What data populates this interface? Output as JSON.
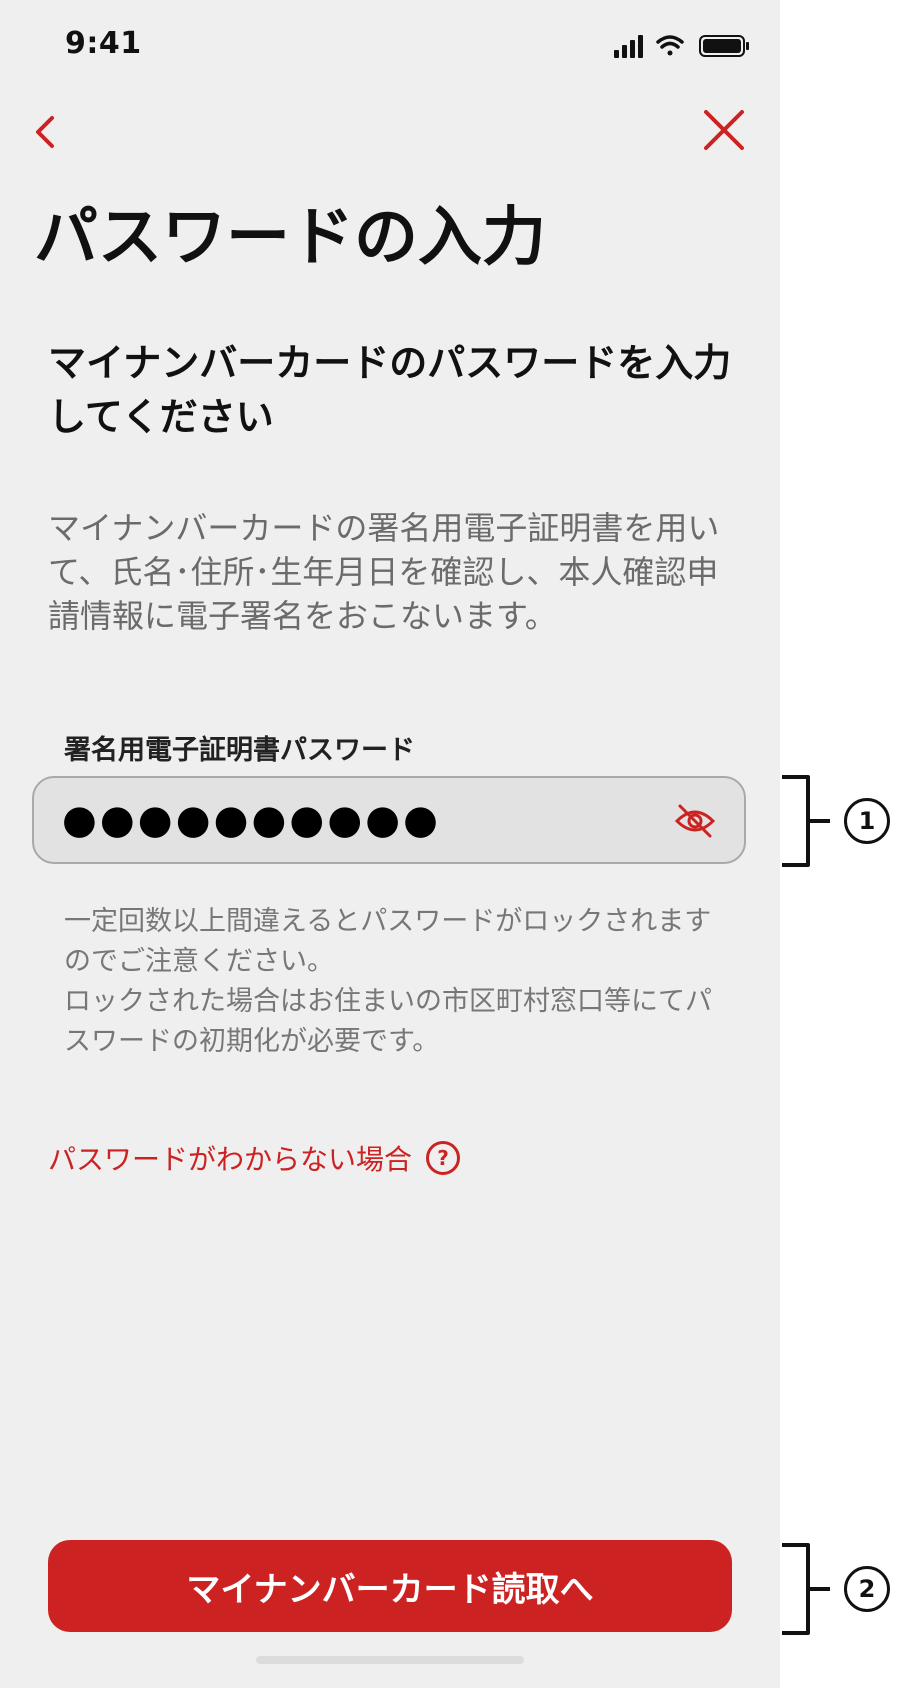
{
  "status_bar": {
    "time": "9:41",
    "icons": [
      "signal-icon",
      "wifi-icon",
      "battery-icon"
    ]
  },
  "nav": {
    "back_icon": "chevron-left-icon",
    "close_icon": "close-icon"
  },
  "page": {
    "title": "パスワードの入力",
    "subtitle": "マイナンバーカードのパスワードを入力してください",
    "description": "マイナンバーカードの署名用電子証明書を用いて、氏名･住所･生年月日を確認し、本人確認申請情報に電子署名をおこないます。"
  },
  "password_field": {
    "label": "署名用電子証明書パスワード",
    "value": "●●●●●●●●●●",
    "visibility_icon": "eye-off-icon"
  },
  "note": "一定回数以上間違えるとパスワードがロックされますのでご注意ください。\nロックされた場合はお住まいの市区町村窓口等にてパスワードの初期化が必要です。",
  "help_link": {
    "label": "パスワードがわからない場合",
    "icon": "question-circle-icon",
    "icon_glyph": "?"
  },
  "primary_button": {
    "label": "マイナンバーカード読取へ"
  },
  "annotations": [
    "1",
    "2"
  ],
  "colors": {
    "accent": "#cc2222",
    "background": "#efefef",
    "field_background": "#e2e2e2"
  }
}
